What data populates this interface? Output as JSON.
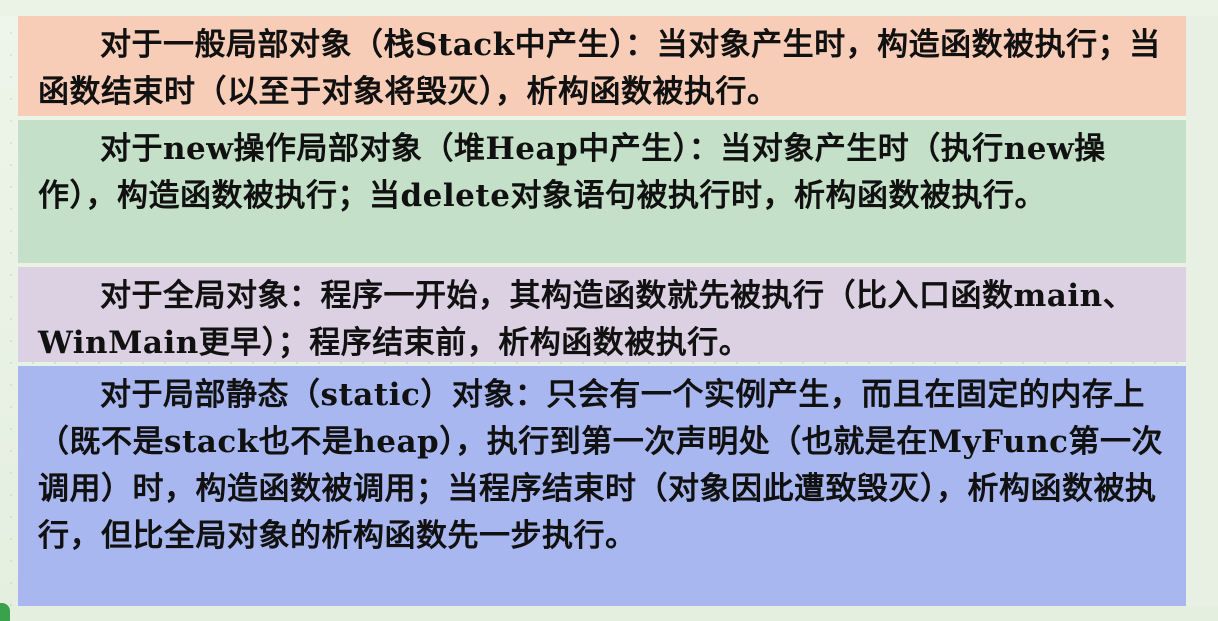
{
  "paragraphs": [
    {
      "text": "对于一般局部对象（栈Stack中产生）：当对象产生时，构造函数被执行；当函数结束时（以至于对象将毁灭），析构函数被执行。",
      "color": "#f8cdb7"
    },
    {
      "text": "对于new操作局部对象（堆Heap中产生）：当对象产生时（执行new操作），构造函数被执行；当delete对象语句被执行时，析构函数被执行。",
      "color": "#c4e0c8"
    },
    {
      "text": "对于全局对象：程序一开始，其构造函数就先被执行（比入口函数main、WinMain更早）；程序结束前，析构函数被执行。",
      "color": "#dcd0e3"
    },
    {
      "text": "对于局部静态（static）对象：只会有一个实例产生，而且在固定的内存上（既不是stack也不是heap），执行到第一次声明处（也就是在MyFunc第一次调用）时，构造函数被调用；当程序结束时（对象因此遭致毁灭），析构函数被执行，但比全局对象的析构函数先一步执行。",
      "color": "#a9b7f0"
    }
  ]
}
